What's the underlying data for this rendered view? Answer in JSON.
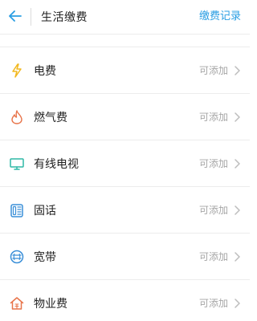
{
  "header": {
    "title": "生活缴费",
    "record_link": "缴费记录"
  },
  "items": [
    {
      "label": "电费",
      "status": "可添加",
      "icon": "lightning-icon",
      "color": "#f2b81f"
    },
    {
      "label": "燃气费",
      "status": "可添加",
      "icon": "flame-icon",
      "color": "#e8744a"
    },
    {
      "label": "有线电视",
      "status": "可添加",
      "icon": "tv-icon",
      "color": "#2fb8a6"
    },
    {
      "label": "固话",
      "status": "可添加",
      "icon": "phone-icon",
      "color": "#3a8fd8"
    },
    {
      "label": "宽带",
      "status": "可添加",
      "icon": "broadband-icon",
      "color": "#3a8fd8"
    },
    {
      "label": "物业费",
      "status": "可添加",
      "icon": "house-icon",
      "color": "#e8744a"
    }
  ],
  "colors": {
    "accent": "#2a9ee3",
    "status_text": "#a6a6a6",
    "divider": "#ececec"
  }
}
